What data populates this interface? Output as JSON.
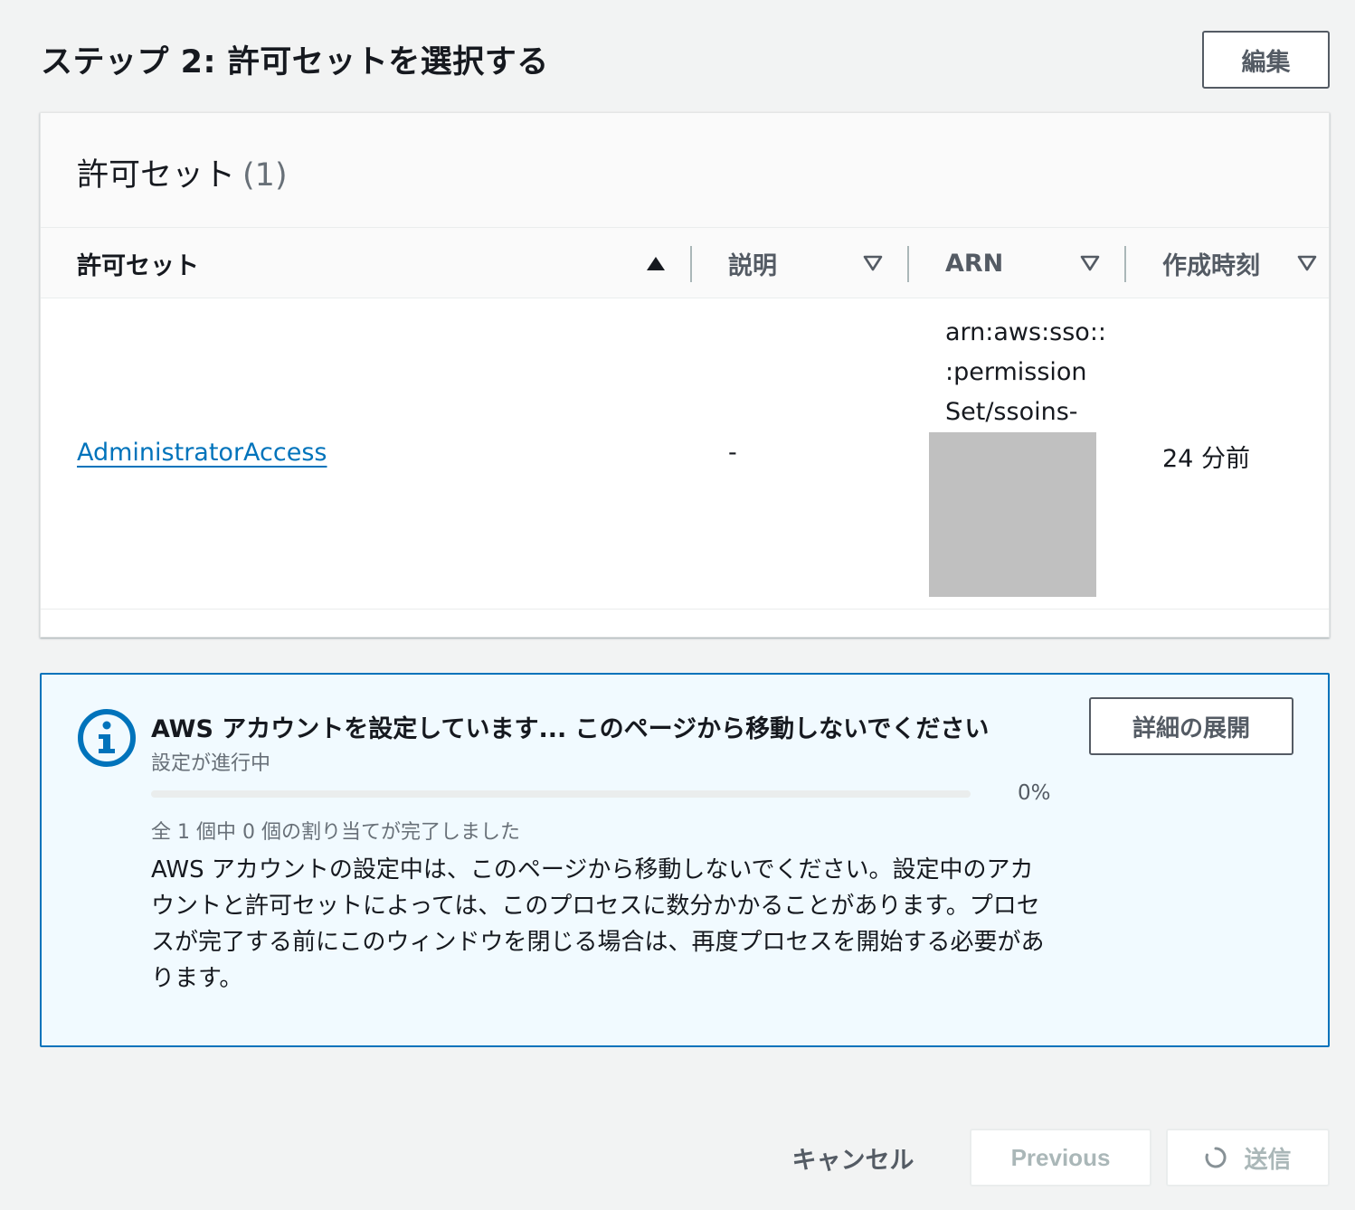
{
  "step": {
    "title": "ステップ 2: 許可セットを選択する",
    "edit_label": "編集"
  },
  "panel": {
    "title": "許可セット",
    "count": "(1)",
    "columns": [
      {
        "label": "許可セット",
        "sort": "ascending"
      },
      {
        "label": "説明",
        "sort": "none"
      },
      {
        "label": "ARN",
        "sort": "none"
      },
      {
        "label": "作成時刻",
        "sort": "none"
      }
    ],
    "rows": [
      {
        "name": "AdministratorAccess",
        "description": "-",
        "arn_lines": [
          "arn:aws:sso::",
          ":permission",
          "Set/ssoins-"
        ],
        "created": "24 分前"
      }
    ]
  },
  "flash": {
    "header": "AWS アカウントを設定しています... このページから移動しないでください",
    "subheader": "設定が進行中",
    "progress_value": 0,
    "progress_label": "0%",
    "progress_description": "全 1 個中 0 個の割り当てが完了しました",
    "body": "AWS アカウントの設定中は、このページから移動しないでください。設定中のアカウントと許可セットによっては、このプロセスに数分かかることがあります。プロセスが完了する前にこのウィンドウを閉じる場合は、再度プロセスを開始する必要があります。",
    "expand_label": "詳細の展開"
  },
  "footer": {
    "cancel_label": "キャンセル",
    "previous_label": "Previous",
    "submit_label": "送信"
  },
  "colors": {
    "accent": "#0073bb",
    "background": "#f2f3f3",
    "flash_background": "#f1faff",
    "disabled_text": "#aab7b8"
  }
}
